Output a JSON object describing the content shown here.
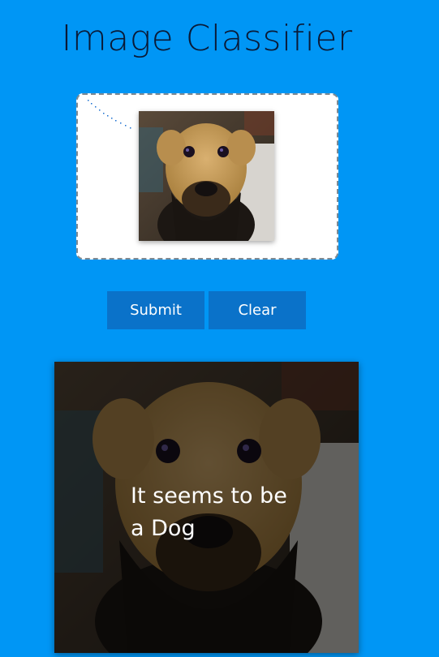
{
  "app": {
    "title": "Image Classifier"
  },
  "upload": {
    "image_icon": "dog-photo-icon"
  },
  "actions": {
    "submit_label": "Submit",
    "clear_label": "Clear"
  },
  "result": {
    "text": "It seems to be a Dog",
    "image_icon": "dog-photo-icon"
  },
  "colors": {
    "background": "#0096f5",
    "button": "#0a72c9",
    "title_text": "#0a1a36",
    "dropzone_border": "#7f8a93"
  }
}
